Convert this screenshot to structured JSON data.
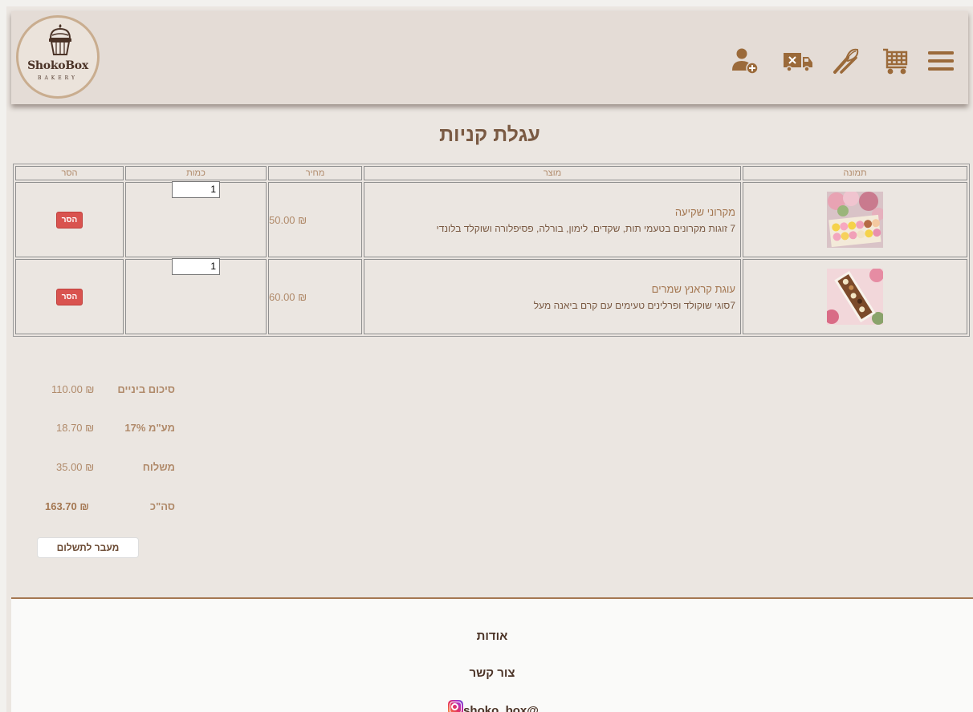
{
  "brand": {
    "name": "ShokoBox",
    "subtitle": "BAKERY"
  },
  "header": {
    "icons": [
      "menu-icon",
      "cart-icon",
      "whisk-icon",
      "delivery-truck-icon",
      "add-user-icon"
    ],
    "icon_color": "#9b6a3a"
  },
  "page_title": "עגלת קניות",
  "cart": {
    "headers": {
      "image": "תמונה",
      "product": "מוצר",
      "price": "מחיר",
      "quantity": "כמות",
      "remove": "הסר"
    },
    "items": [
      {
        "name": "מקרוני שקיעה",
        "description": "7 זוגות מקרונים בטעמי תות, שקדים, לימון, בורלה, פסיפלורה ושוקלד בלונדי",
        "price": "₪ 50.00",
        "quantity": "1",
        "remove_label": "הסר"
      },
      {
        "name": "עוגת קראנץ שמרים",
        "description": "7סוגי שוקולד ופרלינים טעימים עם קרם ביאנה מעל",
        "price": "₪ 60.00",
        "quantity": "1",
        "remove_label": "הסר"
      }
    ]
  },
  "summary": {
    "subtotal_label": "סיכום ביניים",
    "subtotal": "₪ 110.00",
    "vat_label": "מע\"מ 17%",
    "vat": "₪ 18.70",
    "shipping_label": "משלוח",
    "shipping": "₪ 35.00",
    "total_label": "סה\"כ",
    "total": "₪ 163.70",
    "checkout_label": "מעבר לתשלום"
  },
  "footer": {
    "about": "אודות",
    "contact": "צור קשר",
    "instagram": "@shoko_box"
  },
  "colors": {
    "accent": "#a47751",
    "remove_button": "#d9534f",
    "header_bg": "#e4dcd6"
  }
}
